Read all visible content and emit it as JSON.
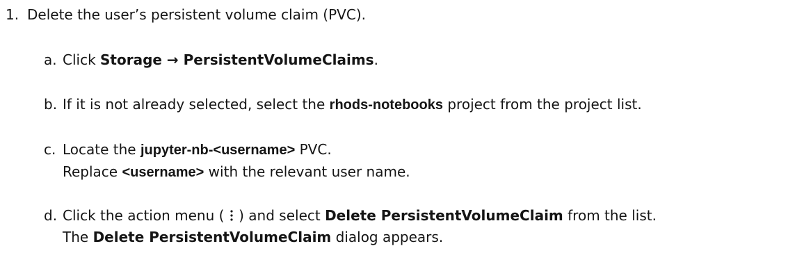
{
  "step": {
    "number": "1.",
    "text": "Delete the user’s persistent volume claim (PVC)."
  },
  "substeps": {
    "a": {
      "letter": "a.",
      "prefix": "Click ",
      "menu_path": "Storage → PersistentVolumeClaims",
      "suffix": "."
    },
    "b": {
      "letter": "b.",
      "prefix": "If it is not already selected, select the ",
      "project": "rhods-notebooks",
      "suffix": " project from the project list."
    },
    "c": {
      "letter": "c.",
      "line1_prefix": "Locate the ",
      "pvc_name": "jupyter-nb-<username>",
      "line1_suffix": " PVC.",
      "line2_prefix": "Replace ",
      "placeholder": "<username>",
      "line2_suffix": " with the relevant user name."
    },
    "d": {
      "letter": "d.",
      "line1_prefix": "Click the action menu ( ",
      "kebab_icon": "kebab-menu-icon",
      "line1_mid": " ) and select ",
      "action": "Delete PersistentVolumeClaim",
      "line1_suffix": " from the list.",
      "line2_prefix": "The ",
      "dialog": "Delete PersistentVolumeClaim",
      "line2_suffix": " dialog appears."
    }
  }
}
